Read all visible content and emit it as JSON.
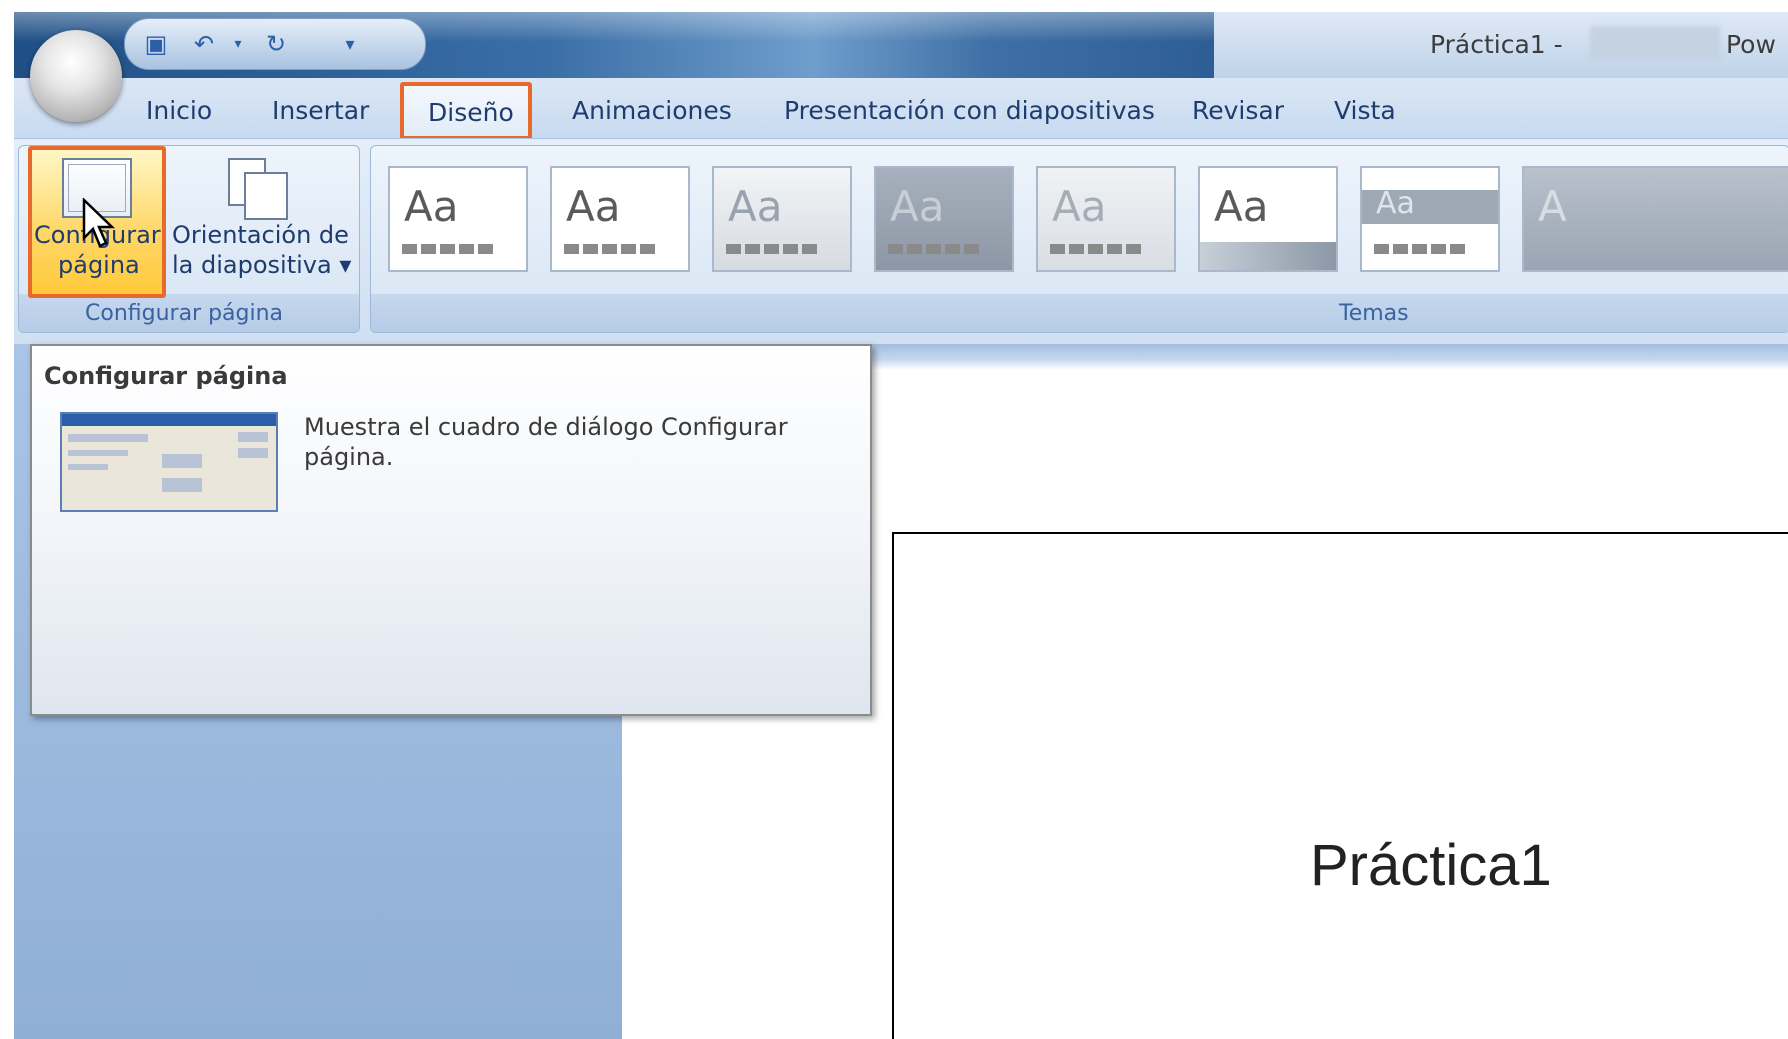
{
  "window": {
    "title": "Práctica1 -",
    "app_name": "Pow"
  },
  "quick_access": {
    "icons": [
      "save-icon",
      "undo-icon",
      "redo-icon",
      "customize-qat-icon"
    ]
  },
  "tabs": [
    {
      "label": "Inicio"
    },
    {
      "label": "Insertar"
    },
    {
      "label": "Diseño",
      "active": true
    },
    {
      "label": "Animaciones"
    },
    {
      "label": "Presentación con diapositivas"
    },
    {
      "label": "Revisar"
    },
    {
      "label": "Vista"
    }
  ],
  "ribbon": {
    "page_setup_group": {
      "label": "Configurar página",
      "config_button": {
        "line1": "Configurar",
        "line2": "página"
      },
      "orientation_button": {
        "line1": "Orientación de",
        "line2": "la diapositiva ▾"
      }
    },
    "themes_group": {
      "label": "Temas",
      "themes": [
        {
          "sample": "Aa",
          "bg": "#ffffff",
          "fg": "#5a5a5a"
        },
        {
          "sample": "Aa",
          "bg": "#ffffff",
          "fg": "#5a5a5a"
        },
        {
          "sample": "Aa",
          "bg": "#e3e6ea",
          "fg": "#9aa2ad"
        },
        {
          "sample": "Aa",
          "bg": "#9aa4b2",
          "fg": "#c8ced6"
        },
        {
          "sample": "Aa",
          "bg": "#e5e8ec",
          "fg": "#a6adb6"
        },
        {
          "sample": "Aa",
          "bg": "#ffffff",
          "fg": "#5a5a5a"
        },
        {
          "sample": "Aa",
          "bg": "#dfe4ea",
          "fg": "#6d7886"
        },
        {
          "sample": "A",
          "bg": "#a9b3c0",
          "fg": "#d8dde3"
        }
      ]
    }
  },
  "tooltip": {
    "title": "Configurar página",
    "description": "Muestra el cuadro de diálogo Configurar página."
  },
  "slide": {
    "title": "Práctica1"
  },
  "colors": {
    "highlight": "#e8692c",
    "tab_text": "#1e3d6e",
    "group_label": "#3a62a1"
  }
}
